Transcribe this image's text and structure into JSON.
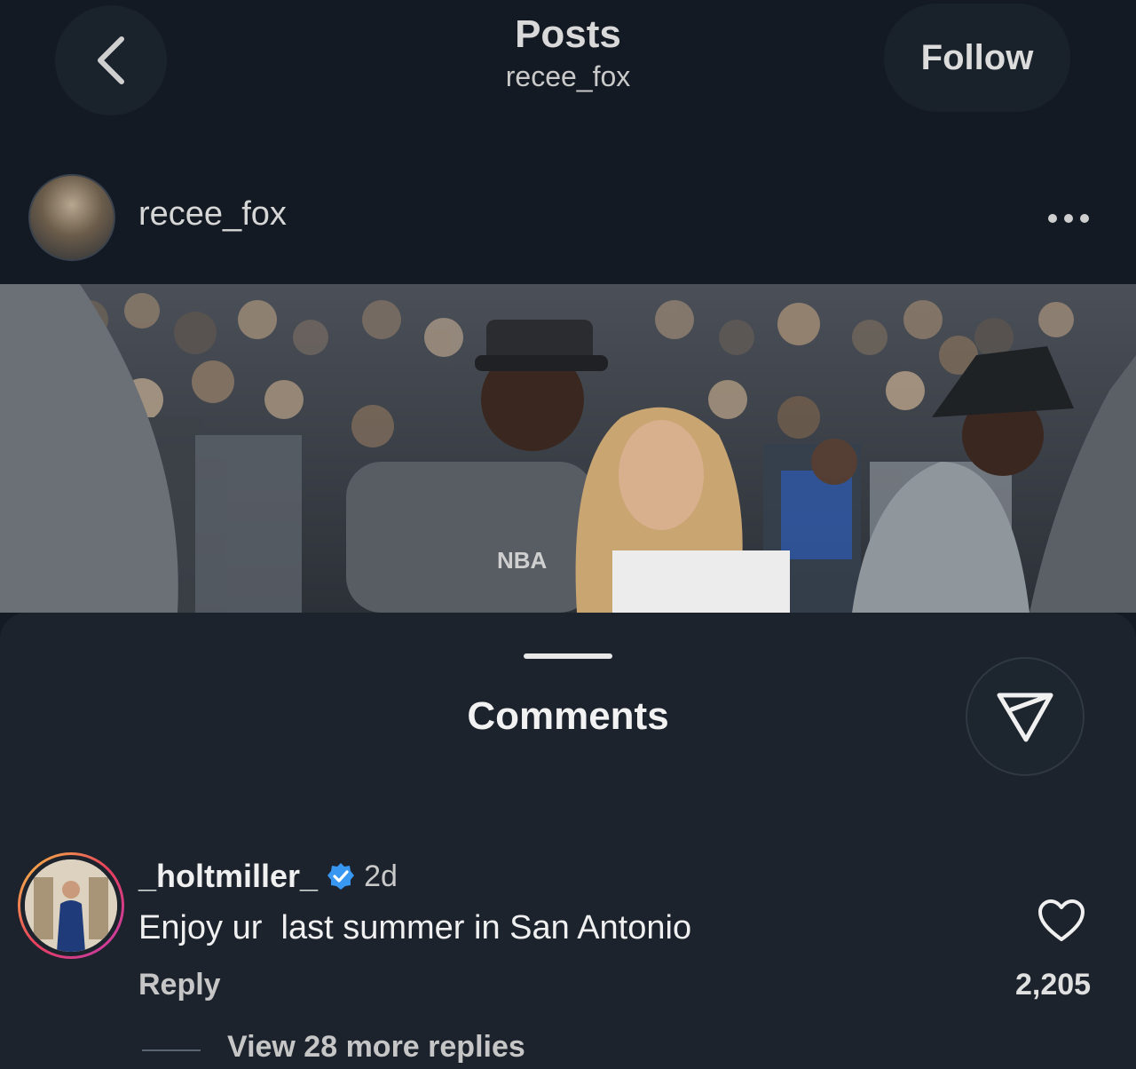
{
  "header": {
    "title": "Posts",
    "subtitle": "recee_fox",
    "follow_label": "Follow"
  },
  "post": {
    "author": "recee_fox"
  },
  "comments_sheet": {
    "title": "Comments",
    "comment": {
      "username": "_holtmiller_",
      "time": "2d",
      "text": "Enjoy ur  last summer in San Antonio",
      "reply_label": "Reply",
      "like_count": "2,205",
      "view_replies_label": "View 28 more replies"
    }
  },
  "icons": {
    "back": "chevron-left-icon",
    "more": "more-horizontal-icon",
    "share": "paper-plane-icon",
    "like": "heart-outline-icon",
    "verified": "verified-badge-icon"
  },
  "colors": {
    "background": "#141b24",
    "sheet": "#1c232d",
    "verified_blue": "#3897f0"
  }
}
